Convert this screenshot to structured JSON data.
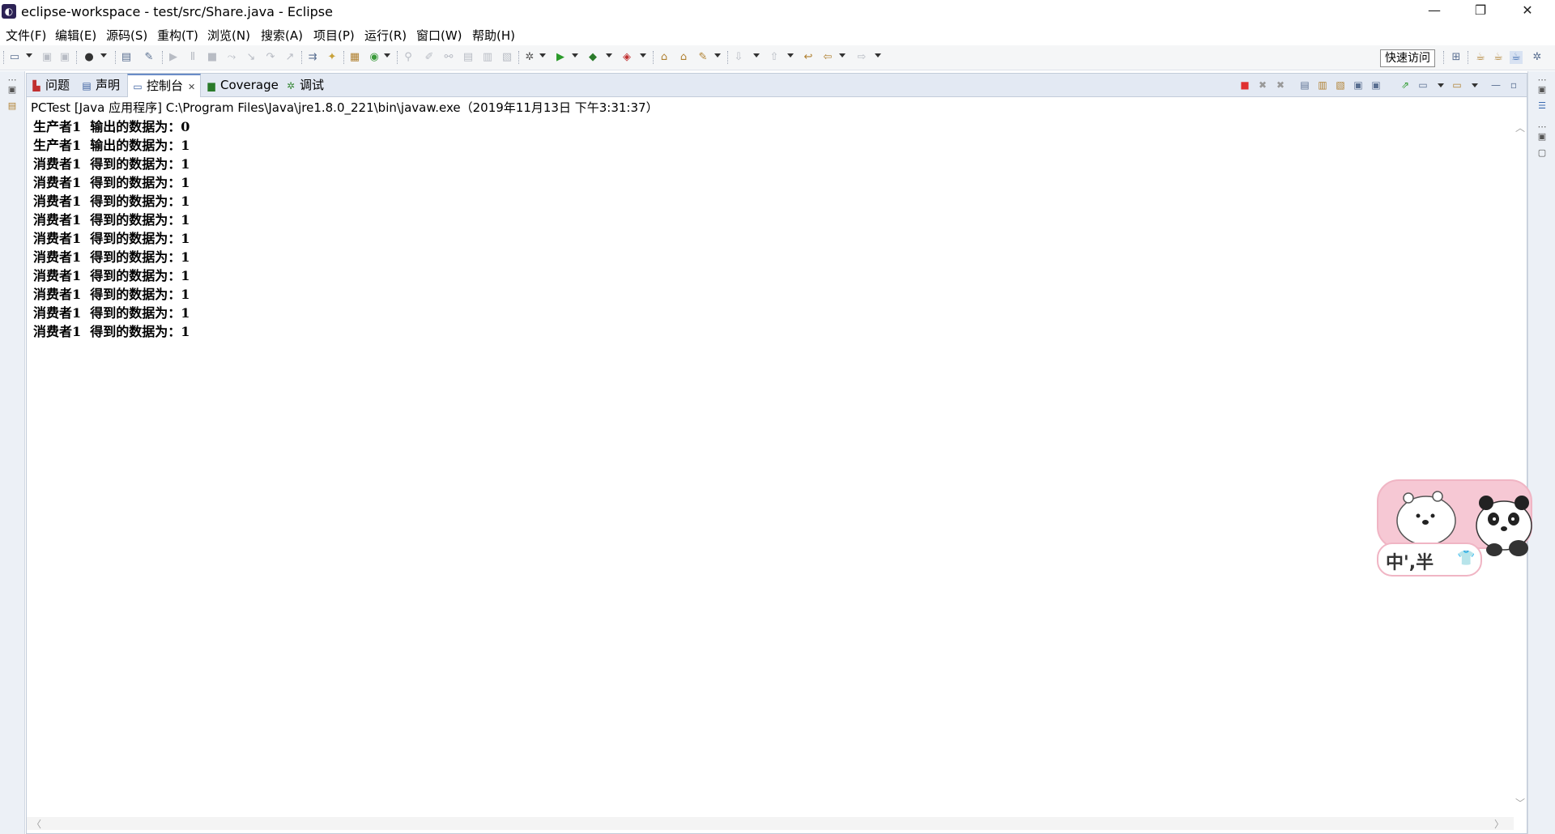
{
  "window": {
    "title": "eclipse-workspace - test/src/Share.java - Eclipse",
    "minimize": "—",
    "restore": "❐",
    "close": "✕"
  },
  "menu": [
    "文件(F)",
    "编辑(E)",
    "源码(S)",
    "重构(T)",
    "浏览(N)",
    "搜索(A)",
    "项目(P)",
    "运行(R)",
    "窗口(W)",
    "帮助(H)"
  ],
  "toolbar": {
    "quick_access": "快速访问"
  },
  "tabs": [
    {
      "label": "问题",
      "icon": "problems-icon"
    },
    {
      "label": "声明",
      "icon": "declaration-icon"
    },
    {
      "label": "控制台",
      "icon": "console-icon",
      "active": true,
      "close": "✕"
    },
    {
      "label": "Coverage",
      "icon": "coverage-icon"
    },
    {
      "label": "调试",
      "icon": "debug-icon"
    }
  ],
  "console": {
    "process": "PCTest [Java 应用程序] C:\\Program Files\\Java\\jre1.8.0_221\\bin\\javaw.exe（2019年11月13日 下午3:31:37）",
    "lines": [
      "生产者1  输出的数据为：0",
      "生产者1  输出的数据为：1",
      "消费者1  得到的数据为：1",
      "消费者1  得到的数据为：1",
      "消费者1  得到的数据为：1",
      "消费者1  得到的数据为：1",
      "消费者1  得到的数据为：1",
      "消费者1  得到的数据为：1",
      "消费者1  得到的数据为：1",
      "消费者1  得到的数据为：1",
      "消费者1  得到的数据为：1",
      "消费者1  得到的数据为：1"
    ]
  },
  "sticker": {
    "text": "中',半"
  },
  "colors": {
    "terminate": "#e03030",
    "tab_active_border": "#6a8cc7",
    "trim": "#ecf0f6",
    "sticker_pink": "#f6c8d4"
  }
}
